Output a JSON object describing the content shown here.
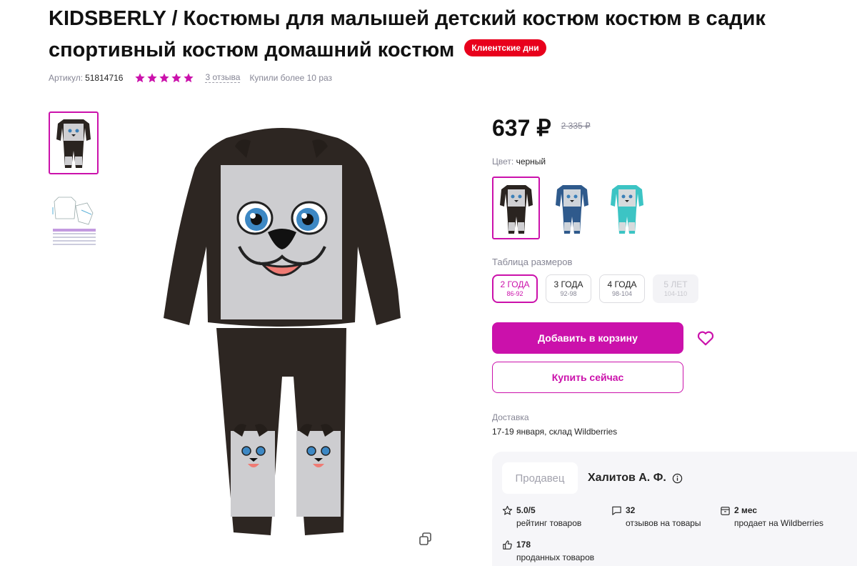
{
  "product": {
    "title": "KIDSBERLY / Костюмы для малышей детский костюм костюм в садик спортивный костюм домашний костюм",
    "badge": "Клиентские дни",
    "article_label": "Артикул:",
    "article": "51814716",
    "rating": 5,
    "reviews": "3 отзыва",
    "bought": "Купили более 10 раз"
  },
  "price": {
    "current": "637 ₽",
    "old": "2 335 ₽"
  },
  "color": {
    "label": "Цвет:",
    "value": "черный"
  },
  "sizes": {
    "label": "Таблица размеров",
    "items": [
      {
        "main": "2 ГОДА",
        "sub": "86-92",
        "state": "selected"
      },
      {
        "main": "3 ГОДА",
        "sub": "92-98",
        "state": "available"
      },
      {
        "main": "4 ГОДА",
        "sub": "98-104",
        "state": "available"
      },
      {
        "main": "5 ЛЕТ",
        "sub": "104-110",
        "state": "unavailable"
      }
    ]
  },
  "actions": {
    "add_to_cart": "Добавить в корзину",
    "buy_now": "Купить сейчас"
  },
  "delivery": {
    "label": "Доставка",
    "value": "17-19 января, склад Wildberries"
  },
  "seller": {
    "tag": "Продавец",
    "name": "Халитов А. Ф.",
    "stats": [
      {
        "icon": "star-icon",
        "value": "5.0/5",
        "label": "рейтинг товаров"
      },
      {
        "icon": "chat-icon",
        "value": "32",
        "label": "отзывов на товары"
      },
      {
        "icon": "box-icon",
        "value": "2 мес",
        "label": "продает на Wildberries"
      },
      {
        "icon": "thumbs-up-icon",
        "value": "178",
        "label": "проданных товаров"
      }
    ]
  },
  "colors": {
    "accent": "#cb11ab",
    "badge": "#e8001c",
    "star": "#cb11ab"
  }
}
